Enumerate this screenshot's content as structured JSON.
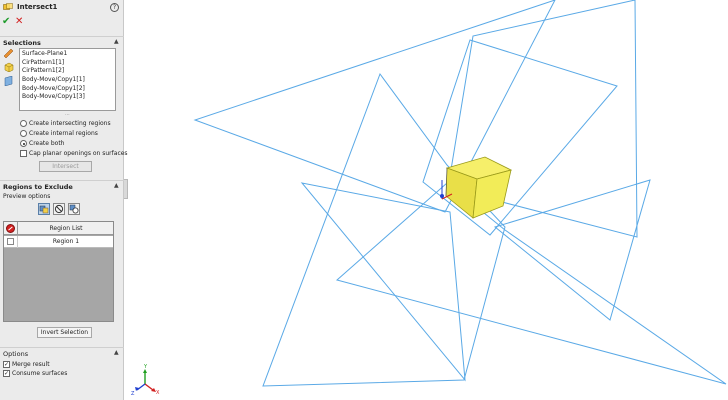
{
  "feature": {
    "title": "Intersect1",
    "help_glyph": "?",
    "ok_glyph": "✔",
    "cancel_glyph": "✕"
  },
  "selections": {
    "header": "Selections",
    "items": [
      "Surface-Plane1",
      "CirPattern1[1]",
      "CirPattern1[2]",
      "Body-Move/Copy1[1]",
      "Body-Move/Copy1[2]",
      "Body-Move/Copy1[3]"
    ],
    "options": [
      {
        "label": "Create intersecting regions",
        "checked": false
      },
      {
        "label": "Create internal regions",
        "checked": false
      },
      {
        "label": "Create both",
        "checked": true
      }
    ],
    "cap_label": "Cap planar openings on surfaces",
    "cap_checked": false,
    "intersect_button": "Intersect"
  },
  "regions": {
    "header": "Regions to Exclude",
    "preview_label": "Preview options",
    "column_header": "Region List",
    "rows": [
      "Region   1"
    ],
    "invert_button": "Invert Selection"
  },
  "options": {
    "header": "Options",
    "merge_label": "Merge result",
    "merge_checked": true,
    "consume_label": "Consume surfaces",
    "consume_checked": true
  },
  "colors": {
    "plane_outline": "#5aa9e6",
    "region_fill": "#f2ec58",
    "region_edge": "#9a9a1a",
    "triad_x": "#d22020",
    "triad_y": "#20a020",
    "triad_z": "#2040d0"
  },
  "icons": {
    "feature": "intersect-feature-icon",
    "help": "help-icon",
    "ok": "checkmark-icon",
    "cancel": "close-icon"
  }
}
